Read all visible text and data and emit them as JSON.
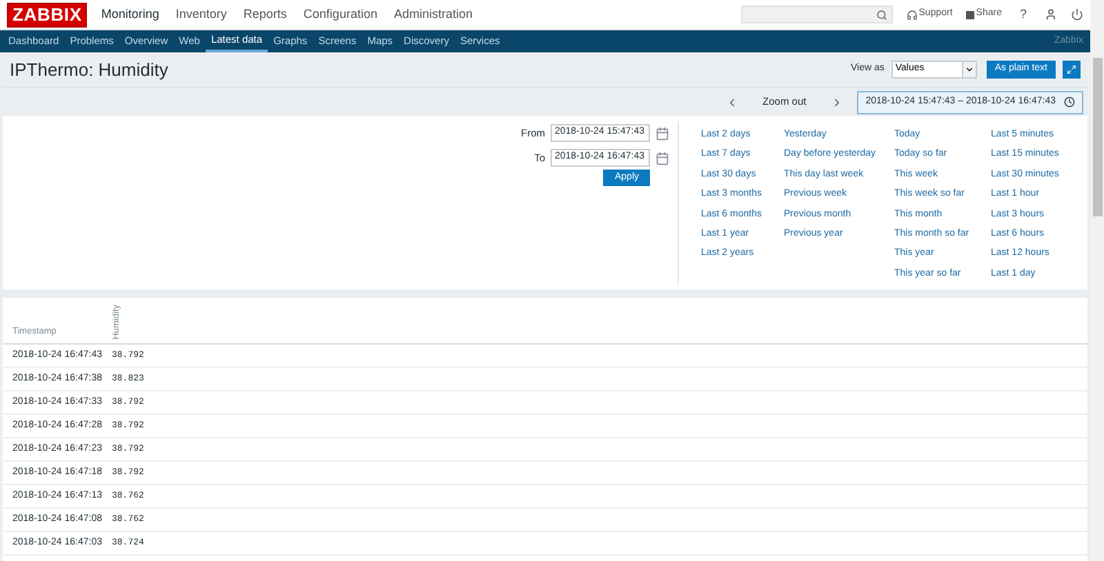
{
  "logo": "ZABBIX",
  "main_menu": [
    {
      "label": "Monitoring",
      "selected": true
    },
    {
      "label": "Inventory",
      "selected": false
    },
    {
      "label": "Reports",
      "selected": false
    },
    {
      "label": "Configuration",
      "selected": false
    },
    {
      "label": "Administration",
      "selected": false
    }
  ],
  "top_links": {
    "support": "Support",
    "share": "Share",
    "help": "?"
  },
  "sub_menu": [
    {
      "label": "Dashboard",
      "selected": false
    },
    {
      "label": "Problems",
      "selected": false
    },
    {
      "label": "Overview",
      "selected": false
    },
    {
      "label": "Web",
      "selected": false
    },
    {
      "label": "Latest data",
      "selected": true
    },
    {
      "label": "Graphs",
      "selected": false
    },
    {
      "label": "Screens",
      "selected": false
    },
    {
      "label": "Maps",
      "selected": false
    },
    {
      "label": "Discovery",
      "selected": false
    },
    {
      "label": "Services",
      "selected": false
    }
  ],
  "server_name": "Zabbix",
  "page_title": "IPThermo: Humidity",
  "view_as": {
    "label": "View as",
    "value": "Values"
  },
  "plain_text_button": "As plain text",
  "timebar": {
    "zoom_out": "Zoom out",
    "range": "2018-10-24 15:47:43 – 2018-10-24 16:47:43"
  },
  "filter": {
    "from_label": "From",
    "from": "2018-10-24 15:47:43",
    "to_label": "To",
    "to": "2018-10-24 16:47:43",
    "apply": "Apply"
  },
  "quick_ranges": [
    [
      "Last 2 days",
      "Last 7 days",
      "Last 30 days",
      "Last 3 months",
      "Last 6 months",
      "Last 1 year",
      "Last 2 years"
    ],
    [
      "Yesterday",
      "Day before yesterday",
      "This day last week",
      "Previous week",
      "Previous month",
      "Previous year"
    ],
    [
      "Today",
      "Today so far",
      "This week",
      "This week so far",
      "This month",
      "This month so far",
      "This year",
      "This year so far"
    ],
    [
      "Last 5 minutes",
      "Last 15 minutes",
      "Last 30 minutes",
      "Last 1 hour",
      "Last 3 hours",
      "Last 6 hours",
      "Last 12 hours",
      "Last 1 day"
    ]
  ],
  "table": {
    "columns": [
      "Timestamp",
      "Humidity"
    ],
    "rows": [
      [
        "2018-10-24 16:47:43",
        "38.792"
      ],
      [
        "2018-10-24 16:47:38",
        "38.823"
      ],
      [
        "2018-10-24 16:47:33",
        "38.792"
      ],
      [
        "2018-10-24 16:47:28",
        "38.792"
      ],
      [
        "2018-10-24 16:47:23",
        "38.792"
      ],
      [
        "2018-10-24 16:47:18",
        "38.792"
      ],
      [
        "2018-10-24 16:47:13",
        "38.762"
      ],
      [
        "2018-10-24 16:47:08",
        "38.762"
      ],
      [
        "2018-10-24 16:47:03",
        "38.724"
      ]
    ]
  }
}
